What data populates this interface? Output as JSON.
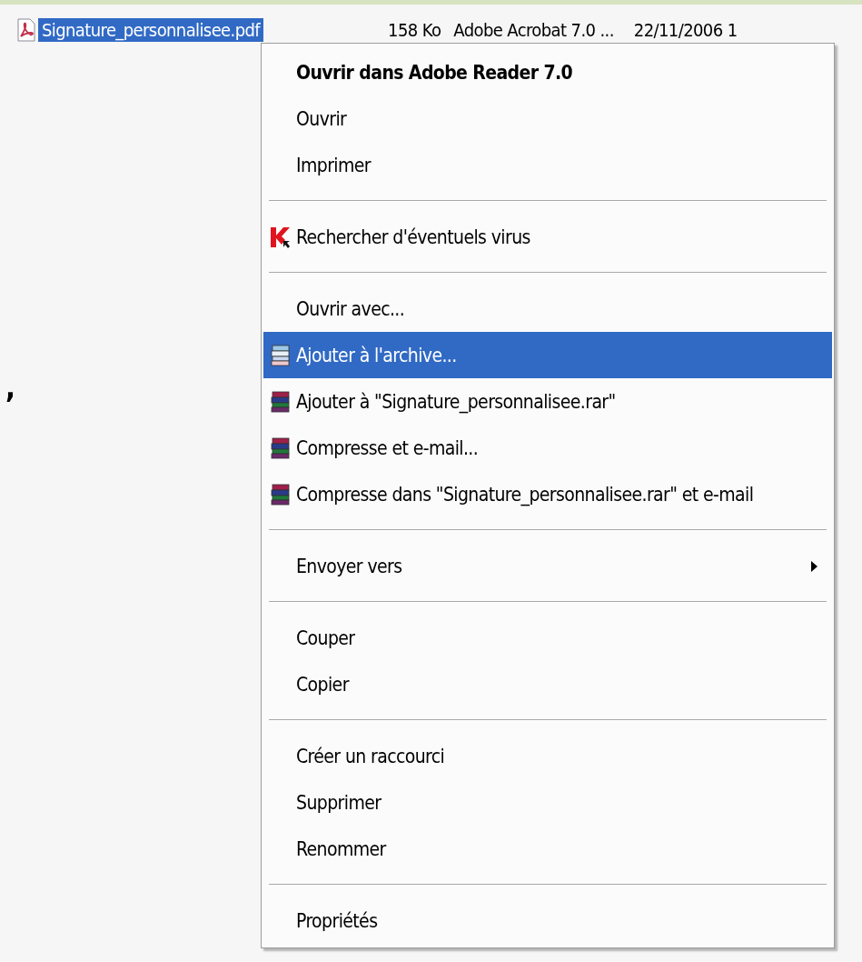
{
  "file_row": {
    "name": "Signature_personnalisee.pdf",
    "selected": true,
    "size": "158 Ko",
    "type": "Adobe Acrobat 7.0 ...",
    "date": "22/11/2006 1"
  },
  "stray_mark": ",",
  "menu": {
    "items": [
      {
        "kind": "plain",
        "label": "Ouvrir dans Adobe Reader 7.0",
        "default": true,
        "selected": false
      },
      {
        "kind": "plain",
        "label": "Ouvrir",
        "default": false,
        "selected": false
      },
      {
        "kind": "plain",
        "label": "Imprimer",
        "default": false,
        "selected": false
      },
      {
        "kind": "separator"
      },
      {
        "kind": "scan",
        "label": "Rechercher d'éventuels virus",
        "default": false,
        "selected": false
      },
      {
        "kind": "separator"
      },
      {
        "kind": "plain",
        "label": "Ouvrir avec...",
        "default": false,
        "selected": false
      },
      {
        "kind": "archive",
        "label": "Ajouter à l'archive...",
        "default": false,
        "selected": true
      },
      {
        "kind": "archive",
        "label": "Ajouter à \"Signature_personnalisee.rar\"",
        "default": false,
        "selected": false
      },
      {
        "kind": "archive",
        "label": "Compresse et e-mail...",
        "default": false,
        "selected": false
      },
      {
        "kind": "archive",
        "label": "Compresse dans \"Signature_personnalisee.rar\" et e-mail",
        "default": false,
        "selected": false
      },
      {
        "kind": "separator"
      },
      {
        "kind": "submenu",
        "label": "Envoyer vers",
        "default": false,
        "selected": false
      },
      {
        "kind": "separator"
      },
      {
        "kind": "plain",
        "label": "Couper",
        "default": false,
        "selected": false
      },
      {
        "kind": "plain",
        "label": "Copier",
        "default": false,
        "selected": false
      },
      {
        "kind": "separator"
      },
      {
        "kind": "plain",
        "label": "Créer un raccourci",
        "default": false,
        "selected": false
      },
      {
        "kind": "plain",
        "label": "Supprimer",
        "default": false,
        "selected": false
      },
      {
        "kind": "plain",
        "label": "Renommer",
        "default": false,
        "selected": false
      },
      {
        "kind": "separator"
      },
      {
        "kind": "plain",
        "label": "Propriétés",
        "default": false,
        "selected": false
      }
    ]
  }
}
